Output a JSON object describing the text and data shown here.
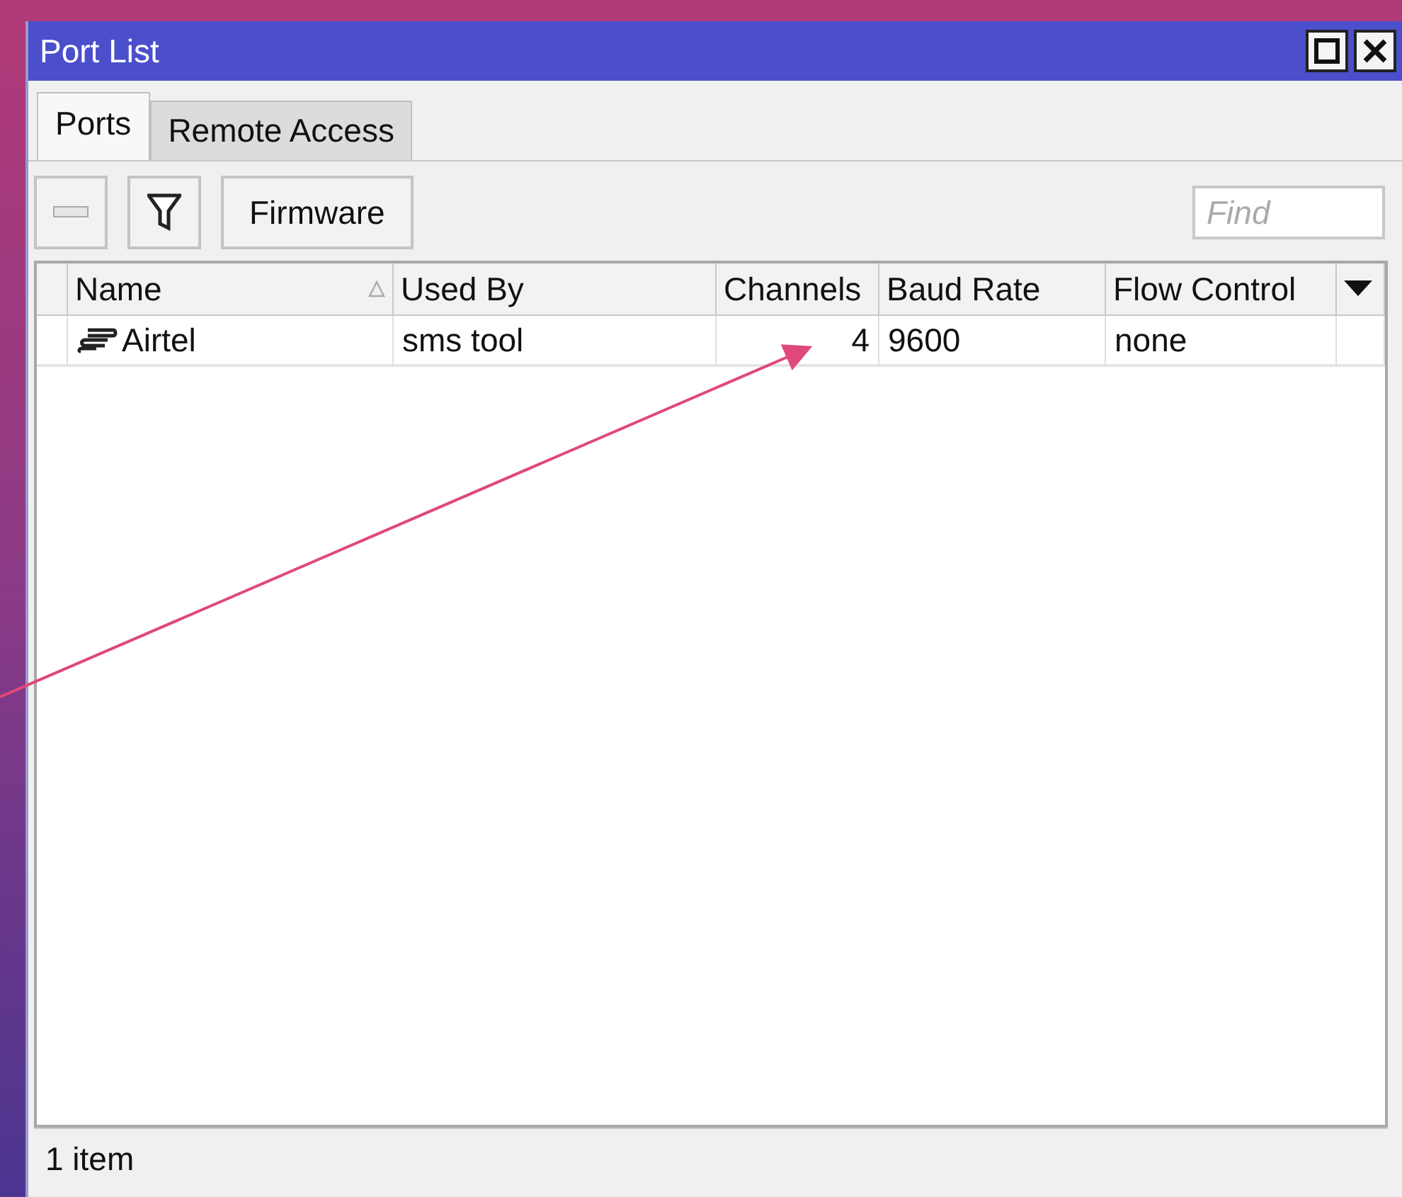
{
  "window": {
    "title": "Port List"
  },
  "tabs": [
    {
      "label": "Ports",
      "selected": true
    },
    {
      "label": "Remote Access",
      "selected": false
    }
  ],
  "toolbar": {
    "buttons": [
      {
        "kind": "remove",
        "disabled": true
      },
      {
        "kind": "filter",
        "disabled": false
      },
      {
        "kind": "text",
        "label": "Firmware",
        "disabled": false
      }
    ],
    "find": {
      "placeholder": "Find"
    }
  },
  "table": {
    "columns": [
      {
        "label": "Name",
        "sorted": true,
        "kind": "text"
      },
      {
        "label": "Used By",
        "sorted": false,
        "kind": "text"
      },
      {
        "label": "Channels",
        "sorted": false,
        "kind": "number"
      },
      {
        "label": "Baud Rate",
        "sorted": false,
        "kind": "text"
      },
      {
        "label": "Flow Control",
        "sorted": false,
        "kind": "text"
      }
    ],
    "rows": [
      {
        "cells": [
          "Airtel",
          "sms tool",
          "4",
          "9600",
          "none"
        ]
      }
    ]
  },
  "status_bar": "1 item"
}
